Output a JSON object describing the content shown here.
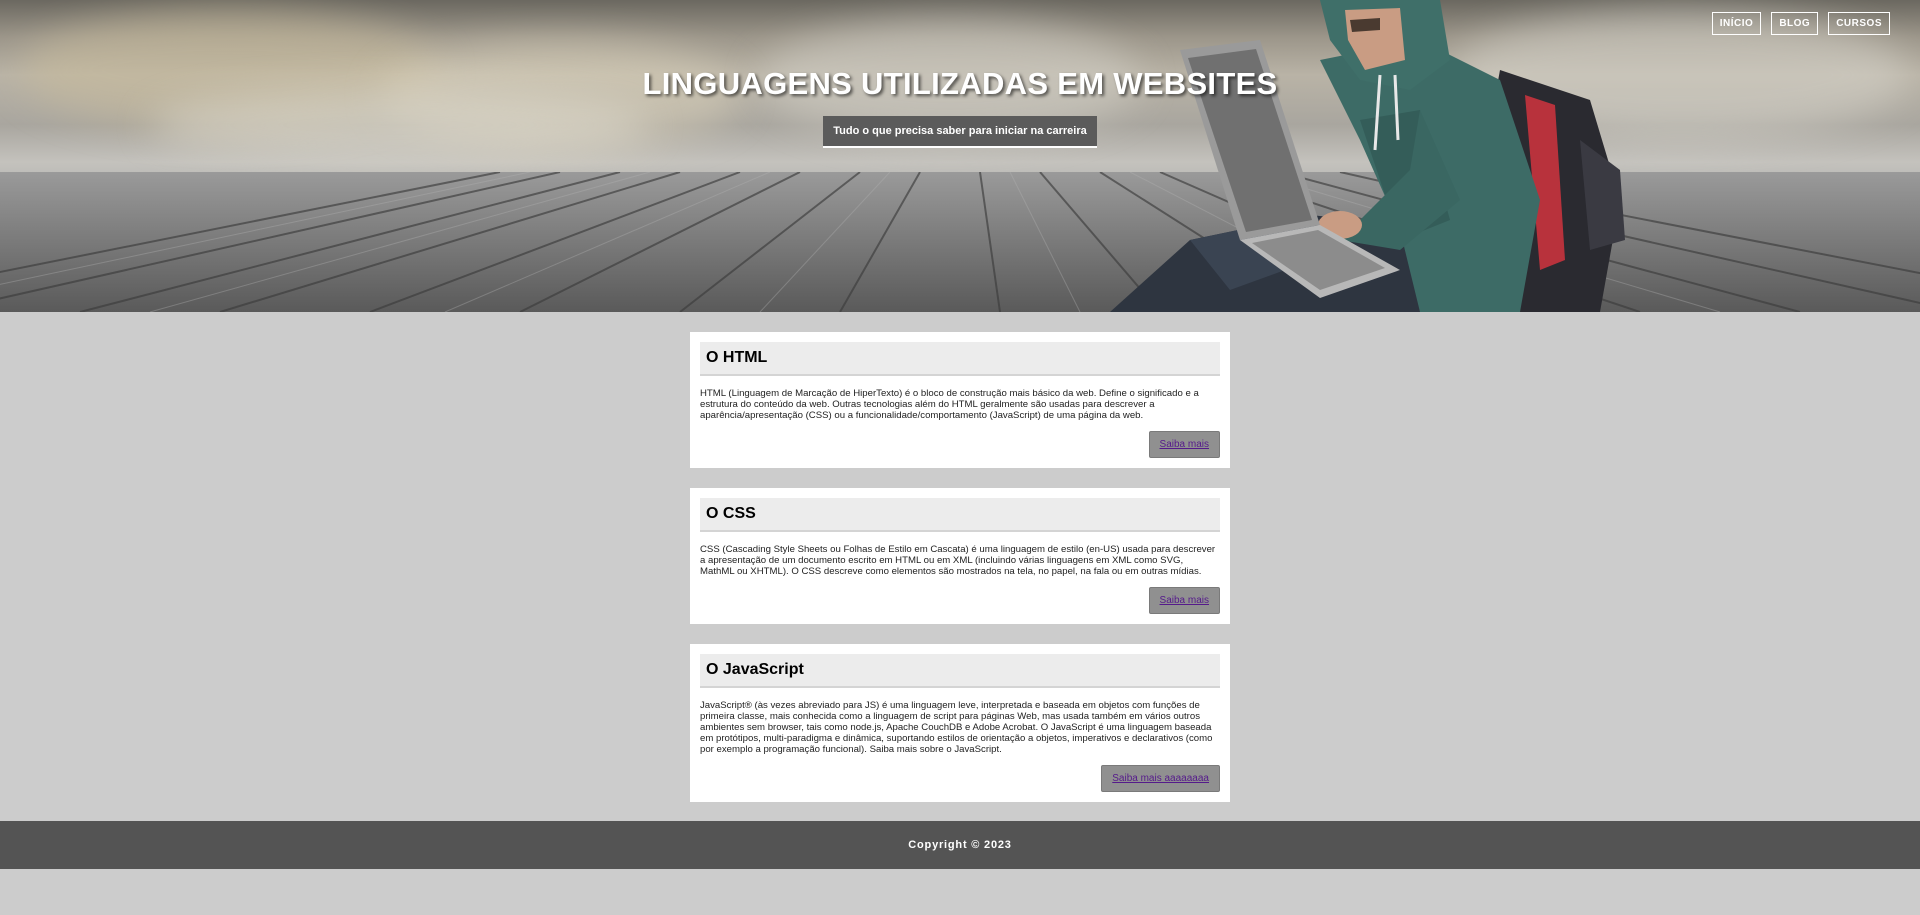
{
  "nav": {
    "items": [
      {
        "label": "INÍCIO"
      },
      {
        "label": "BLOG"
      },
      {
        "label": "CURSOS"
      }
    ]
  },
  "hero": {
    "title": "LINGUAGENS UTILIZADAS EM WEBSITES",
    "subtitle": "Tudo o que precisa saber para iniciar na carreira"
  },
  "cards": [
    {
      "title": "O HTML",
      "text": "HTML (Linguagem de Marcação de HiperTexto) é o bloco de construção mais básico da web. Define o significado e a estrutura do conteúdo da web. Outras tecnologias além do HTML geralmente são usadas para descrever a aparência/apresentação (CSS) ou a funcionalidade/comportamento (JavaScript) de uma página da web.",
      "button": "Saiba mais"
    },
    {
      "title": "O CSS",
      "text": "CSS (Cascading Style Sheets ou Folhas de Estilo em Cascata) é uma linguagem de estilo (en-US) usada para descrever a apresentação de um documento escrito em HTML ou em XML (incluindo várias linguagens em XML como SVG, MathML ou XHTML). O CSS descreve como elementos são mostrados na tela, no papel, na fala ou em outras mídias.",
      "button": "Saiba mais"
    },
    {
      "title": "O JavaScript",
      "text": "JavaScript® (às vezes abreviado para JS) é uma linguagem leve, interpretada e baseada em objetos com funções de primeira classe, mais conhecida como a linguagem de script para páginas Web, mas usada também em vários outros ambientes sem browser, tais como node.js, Apache CouchDB e Adobe Acrobat. O JavaScript é uma linguagem baseada em protótipos, multi-paradigma e dinâmica, suportando estilos de orientação a objetos, imperativos e declarativos (como por exemplo a programação funcional). Saiba mais sobre o JavaScript.",
      "button": "Saiba mais aaaaaaaa"
    }
  ],
  "footer": {
    "copyright": "Copyright © 2023"
  },
  "colors": {
    "page_background": "#cccccc",
    "footer_background": "#545454",
    "button_background": "#909090",
    "link_color": "#551a8b"
  },
  "icons": {
    "hero_image": "person-with-laptop-on-deck-image"
  }
}
